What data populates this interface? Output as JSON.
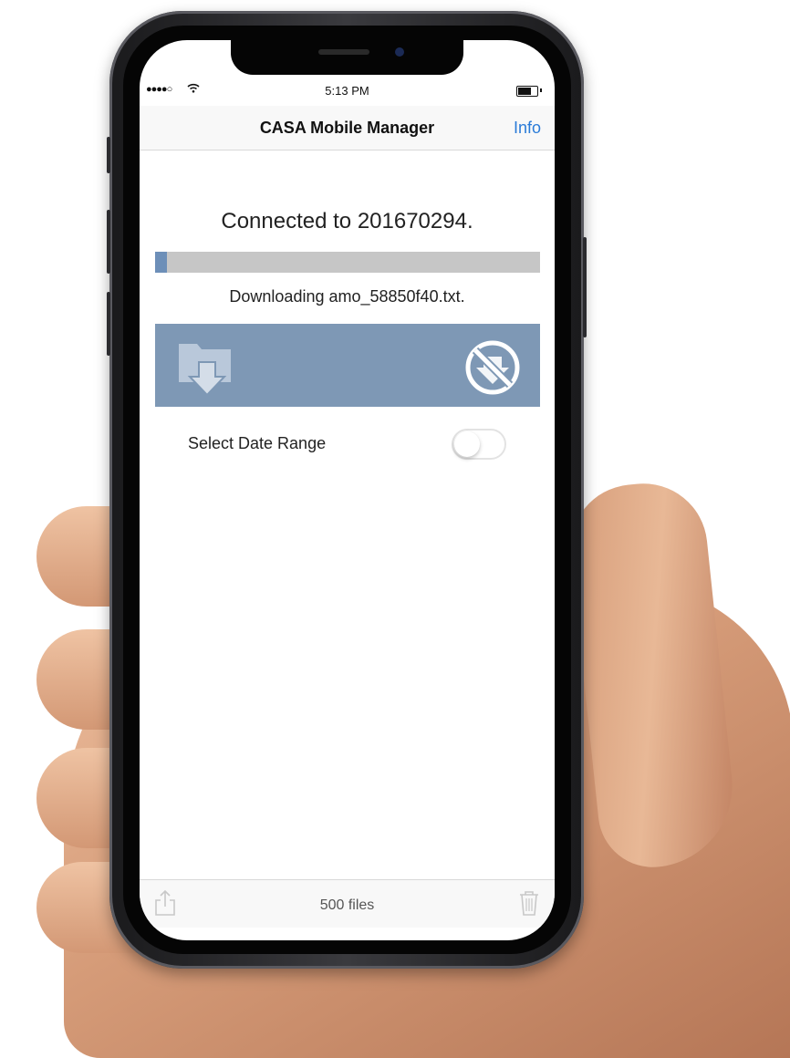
{
  "status_bar": {
    "signal": "●●●●○",
    "time": "5:13 PM"
  },
  "nav": {
    "title": "CASA Mobile Manager",
    "info_label": "Info"
  },
  "connection": {
    "text": "Connected to 201670294."
  },
  "progress": {
    "fraction": 0.03
  },
  "download": {
    "text": "Downloading amo_58850f40.txt."
  },
  "date_range": {
    "label": "Select Date Range",
    "enabled": false
  },
  "toolbar": {
    "files_label": "500 files"
  },
  "colors": {
    "accent": "#2a7bd8",
    "action_bar": "#7e98b5",
    "progress_fill": "#6d8fb8",
    "progress_track": "#c6c6c6"
  },
  "icons": [
    "download-folder-icon",
    "no-download-icon",
    "share-icon",
    "trash-icon",
    "wifi-icon",
    "battery-icon"
  ]
}
